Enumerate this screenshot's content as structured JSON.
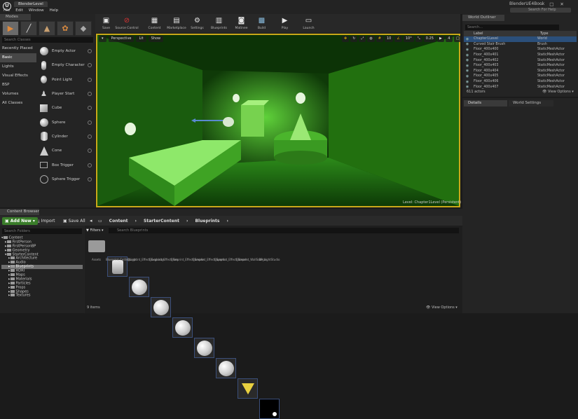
{
  "window": {
    "doc_tab": "BlenderLevel",
    "app_name": "BlenderUE4Book",
    "search_help": "Search For Help",
    "menu": [
      "File",
      "Edit",
      "Window",
      "Help"
    ]
  },
  "modes": {
    "tab": "Modes",
    "search_placeholder": "Search Classes",
    "categories": [
      "Recently Placed",
      "Basic",
      "Lights",
      "Visual Effects",
      "BSP",
      "Volumes",
      "All Classes"
    ],
    "items": [
      "Empty Actor",
      "Empty Character",
      "Point Light",
      "Player Start",
      "Cube",
      "Sphere",
      "Cylinder",
      "Cone",
      "Box Trigger",
      "Sphere Trigger"
    ]
  },
  "toolbar": [
    "Save",
    "Source Control",
    "Content",
    "Marketplace",
    "Settings",
    "Blueprints",
    "Matinee",
    "Build",
    "Play",
    "Launch"
  ],
  "viewport": {
    "perspective": "Perspective",
    "lit": "Lit",
    "show": "Show",
    "snap_grid": "10",
    "snap_rot": "10°",
    "snap_scale": "0.25",
    "cam_speed": "4",
    "level_info": "Level:  Chapter1Level (Persistent)"
  },
  "outliner": {
    "tab": "World Outliner",
    "search_placeholder": "Search...",
    "col_label": "Label",
    "col_type": "Type",
    "rows": [
      {
        "label": "Chapter1Level",
        "type": "World"
      },
      {
        "label": "Curved Stair Brush",
        "type": "Brush"
      },
      {
        "label": "Floor_400x400",
        "type": "StaticMeshActor"
      },
      {
        "label": "Floor_400x401",
        "type": "StaticMeshActor"
      },
      {
        "label": "Floor_400x402",
        "type": "StaticMeshActor"
      },
      {
        "label": "Floor_400x403",
        "type": "StaticMeshActor"
      },
      {
        "label": "Floor_400x404",
        "type": "StaticMeshActor"
      },
      {
        "label": "Floor_400x405",
        "type": "StaticMeshActor"
      },
      {
        "label": "Floor_400x406",
        "type": "StaticMeshActor"
      },
      {
        "label": "Floor_400x407",
        "type": "StaticMeshActor"
      }
    ],
    "count": "611 actors",
    "view_options": "View Options"
  },
  "details_tabs": [
    "Details",
    "World Settings"
  ],
  "content_browser": {
    "tab": "Content Browser",
    "add_new": "Add New",
    "import": "Import",
    "save_all": "Save All",
    "breadcrumb": [
      "Content",
      "StarterContent",
      "Blueprints"
    ],
    "search_folders": "Search Folders",
    "filters": "Filters",
    "search_assets": "Search Blueprints",
    "tree": [
      {
        "label": "Content",
        "depth": 0
      },
      {
        "label": "FirstPerson",
        "depth": 1
      },
      {
        "label": "FirstPersonBP",
        "depth": 1
      },
      {
        "label": "Geometry",
        "depth": 1
      },
      {
        "label": "StarterContent",
        "depth": 1
      },
      {
        "label": "Architecture",
        "depth": 2
      },
      {
        "label": "Audio",
        "depth": 2
      },
      {
        "label": "Blueprints",
        "depth": 2,
        "selected": true
      },
      {
        "label": "HDRI",
        "depth": 2
      },
      {
        "label": "Maps",
        "depth": 2
      },
      {
        "label": "Materials",
        "depth": 2
      },
      {
        "label": "Particles",
        "depth": 2
      },
      {
        "label": "Props",
        "depth": 2
      },
      {
        "label": "Shapes",
        "depth": 2
      },
      {
        "label": "Textures",
        "depth": 2
      }
    ],
    "assets": [
      "Assets",
      "Blueprint_CeilingLight",
      "Blueprint_Effect_Explosion",
      "Blueprint_Effect_Fire",
      "Blueprint_Effect_Smoke",
      "Blueprint_Effect_Sparks",
      "Blueprint_Effect_Steam",
      "Blueprint_WallSconce",
      "BP_LightStudio"
    ],
    "item_count": "9 items",
    "view_options": "View Options"
  }
}
